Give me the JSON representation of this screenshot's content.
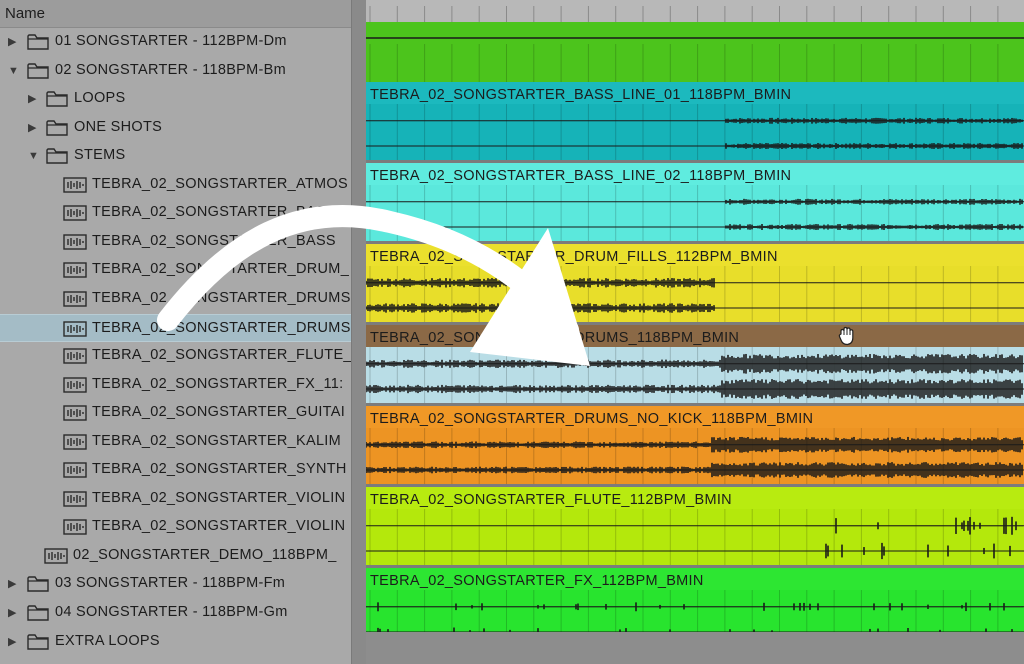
{
  "browser": {
    "header": "Name",
    "items": [
      {
        "label": "01 SONGSTARTER - 112BPM-Dm",
        "kind": "folder",
        "depth": 0,
        "expanded": false
      },
      {
        "label": "02 SONGSTARTER - 118BPM-Bm",
        "kind": "folder",
        "depth": 0,
        "expanded": true
      },
      {
        "label": "LOOPS",
        "kind": "folder",
        "depth": 1,
        "expanded": false
      },
      {
        "label": "ONE SHOTS",
        "kind": "folder",
        "depth": 1,
        "expanded": false
      },
      {
        "label": "STEMS",
        "kind": "folder",
        "depth": 1,
        "expanded": true
      },
      {
        "label": "TEBRA_02_SONGSTARTER_ATMOS",
        "kind": "file",
        "depth": 2
      },
      {
        "label": "TEBRA_02_SONGSTARTER_BASS",
        "kind": "file",
        "depth": 2
      },
      {
        "label": "TEBRA_02_SONGSTARTER_BASS",
        "kind": "file",
        "depth": 2
      },
      {
        "label": "TEBRA_02_SONGSTARTER_DRUM_",
        "kind": "file",
        "depth": 2
      },
      {
        "label": "TEBRA_02_SONGSTARTER_DRUMS",
        "kind": "file",
        "depth": 2
      },
      {
        "label": "TEBRA_02_SONGSTARTER_DRUMS",
        "kind": "file",
        "depth": 2,
        "selected": true
      },
      {
        "label": "TEBRA_02_SONGSTARTER_FLUTE_",
        "kind": "file",
        "depth": 2
      },
      {
        "label": "TEBRA_02_SONGSTARTER_FX_11:",
        "kind": "file",
        "depth": 2
      },
      {
        "label": "TEBRA_02_SONGSTARTER_GUITAI",
        "kind": "file",
        "depth": 2
      },
      {
        "label": "TEBRA_02_SONGSTARTER_KALIM",
        "kind": "file",
        "depth": 2
      },
      {
        "label": "TEBRA_02_SONGSTARTER_SYNTH",
        "kind": "file",
        "depth": 2
      },
      {
        "label": "TEBRA_02_SONGSTARTER_VIOLIN",
        "kind": "file",
        "depth": 2
      },
      {
        "label": "TEBRA_02_SONGSTARTER_VIOLIN",
        "kind": "file",
        "depth": 2
      },
      {
        "label": "02_SONGSTARTER_DEMO_118BPM_",
        "kind": "file",
        "depth": 1
      },
      {
        "label": "03 SONGSTARTER - 118BPM-Fm",
        "kind": "folder",
        "depth": 0,
        "expanded": false
      },
      {
        "label": "04 SONGSTARTER - 118BPM-Gm",
        "kind": "folder",
        "depth": 0,
        "expanded": false
      },
      {
        "label": "EXTRA LOOPS",
        "kind": "folder",
        "depth": 0,
        "expanded": false
      }
    ]
  },
  "tracks": [
    {
      "name": "",
      "color": "#4cc41c",
      "header_color": "#4cc41c"
    },
    {
      "name": "TEBRA_02_SONGSTARTER_BASS_LINE_01_118BPM_BMIN",
      "color": "#16b3b8",
      "header_color": "#1cb9be"
    },
    {
      "name": "TEBRA_02_SONGSTARTER_BASS_LINE_02_118BPM_BMIN",
      "color": "#5be8dc",
      "header_color": "#5fecdf"
    },
    {
      "name": "TEBRA_02_SONGSTARTER_DRUM_FILLS_112BPM_BMIN",
      "color": "#e8de2a",
      "header_color": "#ebe02d"
    },
    {
      "name": "TEBRA_02_SONGSTARTER_DRUMS_118BPM_BMIN",
      "color": "#b9dde6",
      "header_color": "#8b6946"
    },
    {
      "name": "TEBRA_02_SONGSTARTER_DRUMS_NO_KICK_118BPM_BMIN",
      "color": "#ed9423",
      "header_color": "#f09826"
    },
    {
      "name": "TEBRA_02_SONGSTARTER_FLUTE_112BPM_BMIN",
      "color": "#b4e80c",
      "header_color": "#b8eb10"
    },
    {
      "name": "TEBRA_02_SONGSTARTER_FX_112BPM_BMIN",
      "color": "#28e42e",
      "header_color": "#2de632"
    }
  ],
  "colors": {
    "browser_bg": "#a9a9a9",
    "selected_row": "#a4bcc6",
    "arrow": "#ffffff"
  },
  "icons": {
    "folder": "folder-icon",
    "file": "audio-file-icon",
    "collapsed": "triangle-right-icon",
    "expanded": "triangle-down-icon",
    "cursor": "hand-grab-icon",
    "overlay": "curved-arrow-icon"
  }
}
